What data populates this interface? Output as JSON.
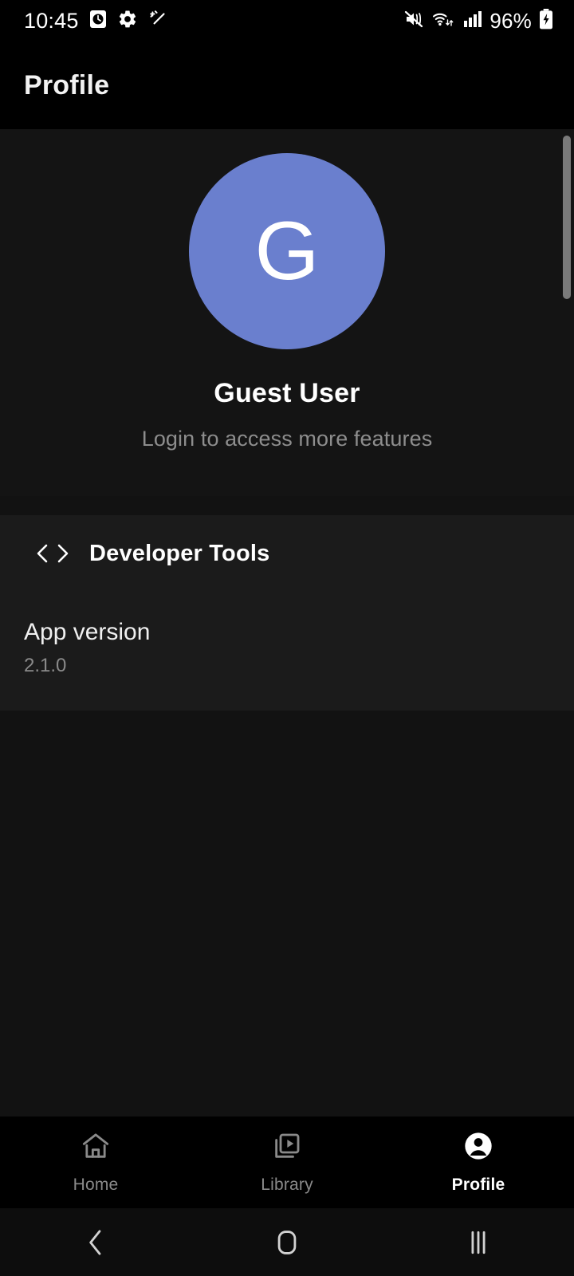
{
  "status_bar": {
    "time": "10:45",
    "battery_percent": "96%",
    "left_icons": [
      "alarm-clock-icon",
      "gear-icon",
      "magic-wand-icon"
    ],
    "right_icons": [
      "mute-vibrate-icon",
      "wifi-icon",
      "cellular-signal-icon",
      "battery-charging-icon"
    ]
  },
  "header": {
    "title": "Profile"
  },
  "profile": {
    "avatar_letter": "G",
    "avatar_color": "#6a7fce",
    "name": "Guest User",
    "subtitle": "Login to access more features"
  },
  "menu": {
    "developer_tools": {
      "label": "Developer Tools",
      "icon": "code-icon"
    }
  },
  "info": {
    "app_version_label": "App version",
    "app_version_value": "2.1.0"
  },
  "bottom_nav": {
    "items": [
      {
        "label": "Home",
        "icon": "home-icon",
        "active": false
      },
      {
        "label": "Library",
        "icon": "video-library-icon",
        "active": false
      },
      {
        "label": "Profile",
        "icon": "account-circle-icon",
        "active": true
      }
    ]
  },
  "system_nav": {
    "back": "back-icon",
    "home": "home-square-icon",
    "recents": "recent-apps-icon"
  },
  "colors": {
    "background": "#0d0d0d",
    "surface": "#1b1b1b",
    "accent": "#6a7fce",
    "text_primary": "#ffffff",
    "text_secondary": "#8a8a8a"
  }
}
